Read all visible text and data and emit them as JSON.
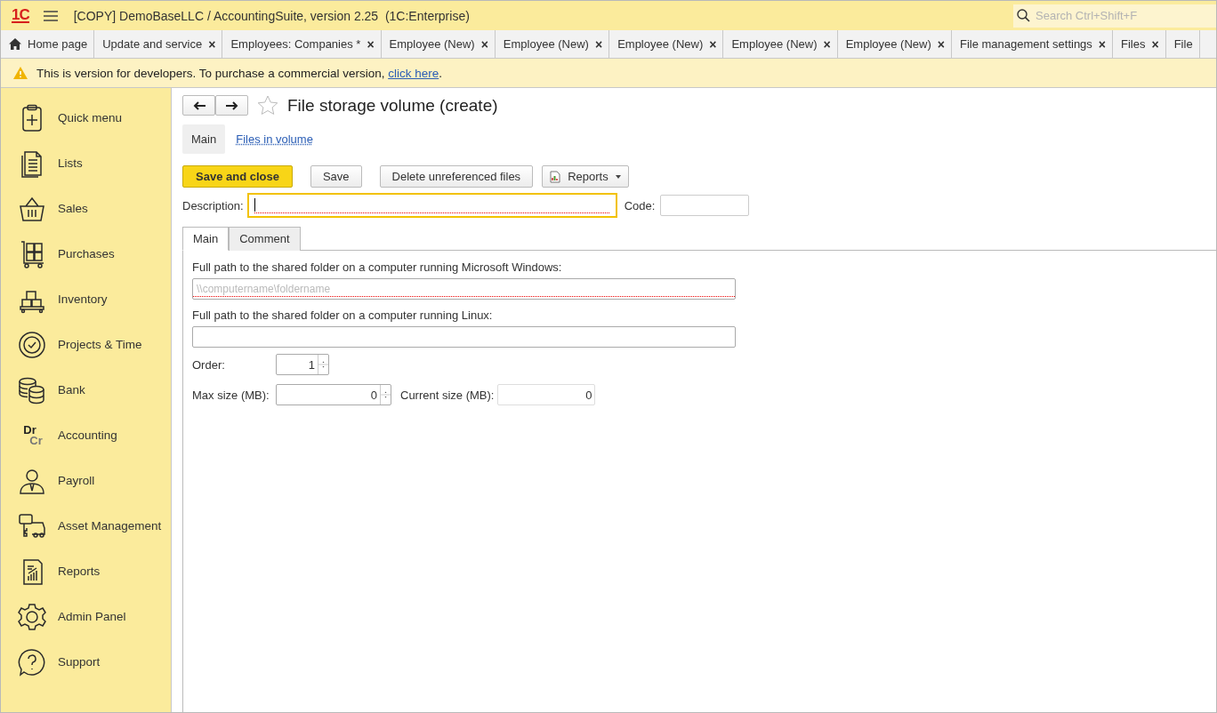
{
  "window": {
    "logo": "1C",
    "title": "[COPY] DemoBaseLLC / AccountingSuite, version 2.25  (1C:Enterprise)"
  },
  "search": {
    "placeholder": "Search Ctrl+Shift+F"
  },
  "tabs": [
    {
      "label": "Home page",
      "kind": "home",
      "selected": false
    },
    {
      "label": "Update and service",
      "close": "×",
      "selected": false
    },
    {
      "label": "Employees: Companies *",
      "close": "×",
      "selected": false
    },
    {
      "label": "Employee (New)",
      "close": "×",
      "selected": false
    },
    {
      "label": "Employee (New)",
      "close": "×",
      "selected": false
    },
    {
      "label": "Employee (New)",
      "close": "×",
      "selected": false
    },
    {
      "label": "Employee (New)",
      "close": "×",
      "selected": false
    },
    {
      "label": "Employee (New)",
      "close": "×",
      "selected": false
    },
    {
      "label": "File management settings",
      "close": "×",
      "selected": false
    },
    {
      "label": "Files",
      "close": "×",
      "selected": false
    },
    {
      "label": "File",
      "selected": false
    }
  ],
  "banner": {
    "text": "This is version for developers. To purchase a commercial version, ",
    "link": "click here",
    "tail": "."
  },
  "sidebar": {
    "items": [
      {
        "label": "Quick menu"
      },
      {
        "label": "Lists"
      },
      {
        "label": "Sales"
      },
      {
        "label": "Purchases"
      },
      {
        "label": "Inventory"
      },
      {
        "label": "Projects & Time"
      },
      {
        "label": "Bank"
      },
      {
        "label": "Accounting",
        "icon_text": [
          "Dr",
          "Cr"
        ]
      },
      {
        "label": "Payroll"
      },
      {
        "label": "Asset Management"
      },
      {
        "label": "Reports"
      },
      {
        "label": "Admin Panel"
      },
      {
        "label": "Support"
      }
    ]
  },
  "form": {
    "title": "File storage volume (create)",
    "favorite": false,
    "sections": [
      {
        "label": "Main",
        "selected": true
      },
      {
        "label": "Files in volume",
        "selected": false
      }
    ],
    "buttons": [
      {
        "label": "Save and close",
        "kind": "primary"
      },
      {
        "label": "Save",
        "kind": "plain"
      },
      {
        "label": "Delete unreferenced files",
        "kind": "plain"
      },
      {
        "label": "Reports",
        "kind": "menu"
      }
    ],
    "description": {
      "label": "Description:",
      "focused": true,
      "required": true
    },
    "code": {
      "label": "Code:"
    },
    "tabs": [
      {
        "label": "Main",
        "selected": true
      },
      {
        "label": "Comment",
        "selected": false
      }
    ],
    "windows_path": {
      "label": "Full path to the shared folder on a computer running Microsoft Windows:",
      "placeholder": "\\\\computername\\foldername",
      "required": true
    },
    "linux_path": {
      "label": "Full path to the shared folder on a computer running Linux:",
      "required": false
    },
    "order": {
      "label": "Order:",
      "value": "1"
    },
    "max_size": {
      "label": "Max size (MB):",
      "value": "0"
    },
    "current_size": {
      "label": "Current size (MB):",
      "value": "0"
    }
  }
}
